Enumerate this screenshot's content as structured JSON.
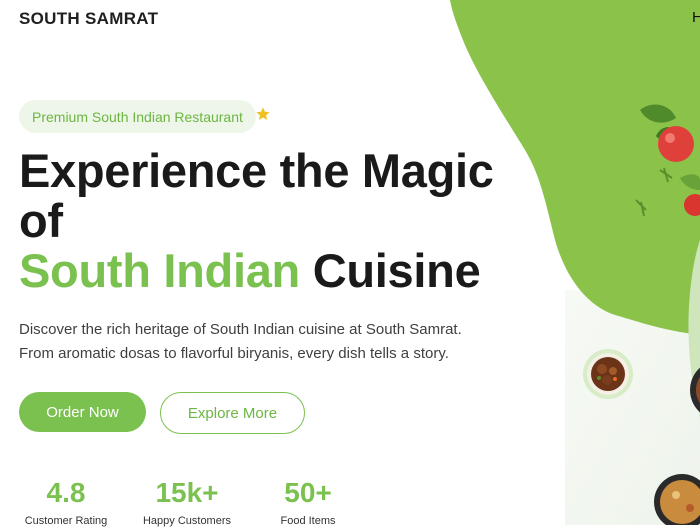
{
  "brand": "SOUTH SAMRAT",
  "nav": {
    "first_item_partial": "H"
  },
  "hero": {
    "badge": "Premium South Indian Restaurant",
    "badge_icon": "star-icon",
    "title_line1": "Experience the Magic",
    "title_line2": "of",
    "title_accent": "South Indian",
    "title_end": "Cuisine",
    "description_line1": "Discover the rich heritage of South Indian cuisine at South Samrat.",
    "description_line2": "From aromatic dosas to flavorful biryanis, every dish tells a story.",
    "primary_button": "Order Now",
    "secondary_button": "Explore More"
  },
  "stats": [
    {
      "value": "4.8",
      "label": "Customer Rating"
    },
    {
      "value": "15k+",
      "label": "Happy Customers"
    },
    {
      "value": "50+",
      "label": "Food Items"
    }
  ],
  "colors": {
    "accent": "#7bc150",
    "badge_bg": "#eef6ea",
    "text_dark": "#1a1a1a",
    "star": "#f0c020"
  }
}
